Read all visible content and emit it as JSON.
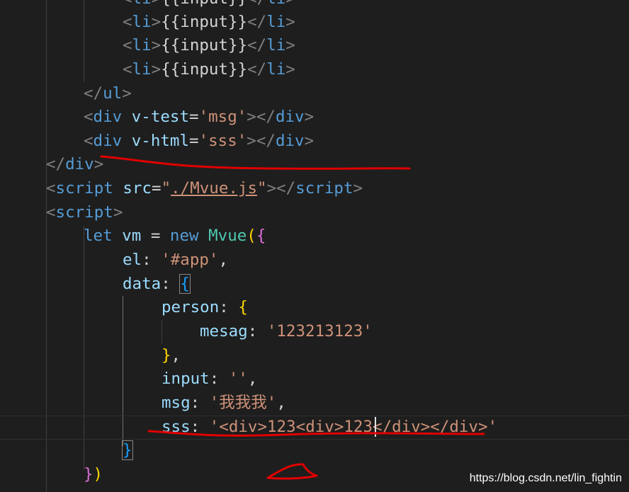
{
  "editor": {
    "lines": [
      [
        {
          "c": "punct",
          "t": "<"
        },
        {
          "c": "tag",
          "t": "li"
        },
        {
          "c": "punct",
          "t": ">"
        },
        {
          "c": "txt",
          "t": "{{input}}"
        },
        {
          "c": "punct",
          "t": "</"
        },
        {
          "c": "tag",
          "t": "li"
        },
        {
          "c": "punct",
          "t": ">"
        }
      ],
      [
        {
          "c": "punct",
          "t": "<"
        },
        {
          "c": "tag",
          "t": "li"
        },
        {
          "c": "punct",
          "t": ">"
        },
        {
          "c": "txt",
          "t": "{{input}}"
        },
        {
          "c": "punct",
          "t": "</"
        },
        {
          "c": "tag",
          "t": "li"
        },
        {
          "c": "punct",
          "t": ">"
        }
      ],
      [
        {
          "c": "punct",
          "t": "<"
        },
        {
          "c": "tag",
          "t": "li"
        },
        {
          "c": "punct",
          "t": ">"
        },
        {
          "c": "txt",
          "t": "{{input}}"
        },
        {
          "c": "punct",
          "t": "</"
        },
        {
          "c": "tag",
          "t": "li"
        },
        {
          "c": "punct",
          "t": ">"
        }
      ],
      [
        {
          "c": "punct",
          "t": "<"
        },
        {
          "c": "tag",
          "t": "li"
        },
        {
          "c": "punct",
          "t": ">"
        },
        {
          "c": "txt",
          "t": "{{input}}"
        },
        {
          "c": "punct",
          "t": "</"
        },
        {
          "c": "tag",
          "t": "li"
        },
        {
          "c": "punct",
          "t": ">"
        }
      ],
      [
        {
          "c": "punct",
          "t": "</"
        },
        {
          "c": "tag",
          "t": "ul"
        },
        {
          "c": "punct",
          "t": ">"
        }
      ],
      [
        {
          "c": "punct",
          "t": "<"
        },
        {
          "c": "tag",
          "t": "div"
        },
        {
          "c": "txt",
          "t": " "
        },
        {
          "c": "attr",
          "t": "v-test"
        },
        {
          "c": "txt",
          "t": "="
        },
        {
          "c": "str",
          "t": "'msg'"
        },
        {
          "c": "punct",
          "t": "></"
        },
        {
          "c": "tag",
          "t": "div"
        },
        {
          "c": "punct",
          "t": ">"
        }
      ],
      [
        {
          "c": "punct",
          "t": "<"
        },
        {
          "c": "tag",
          "t": "div"
        },
        {
          "c": "txt",
          "t": " "
        },
        {
          "c": "attr",
          "t": "v-html"
        },
        {
          "c": "txt",
          "t": "="
        },
        {
          "c": "str",
          "t": "'sss'"
        },
        {
          "c": "punct",
          "t": "></"
        },
        {
          "c": "tag",
          "t": "div"
        },
        {
          "c": "punct",
          "t": ">"
        }
      ],
      [
        {
          "c": "punct",
          "t": "</"
        },
        {
          "c": "tag",
          "t": "div"
        },
        {
          "c": "punct",
          "t": ">"
        }
      ],
      [
        {
          "c": "punct",
          "t": "<"
        },
        {
          "c": "tag",
          "t": "script"
        },
        {
          "c": "txt",
          "t": " "
        },
        {
          "c": "attr",
          "t": "src"
        },
        {
          "c": "txt",
          "t": "="
        },
        {
          "c": "str",
          "t": "\""
        },
        {
          "c": "str link-underline",
          "t": "./Mvue.js"
        },
        {
          "c": "str",
          "t": "\""
        },
        {
          "c": "punct",
          "t": "></"
        },
        {
          "c": "tag",
          "t": "script"
        },
        {
          "c": "punct",
          "t": ">"
        }
      ],
      [
        {
          "c": "punct",
          "t": "<"
        },
        {
          "c": "tag",
          "t": "script"
        },
        {
          "c": "punct",
          "t": ">"
        }
      ],
      [
        {
          "c": "kw",
          "t": "let"
        },
        {
          "c": "txt",
          "t": " "
        },
        {
          "c": "var",
          "t": "vm"
        },
        {
          "c": "txt",
          "t": " = "
        },
        {
          "c": "kw",
          "t": "new"
        },
        {
          "c": "txt",
          "t": " "
        },
        {
          "c": "cls",
          "t": "Mvue"
        },
        {
          "c": "brace1",
          "t": "("
        },
        {
          "c": "brace2",
          "t": "{"
        }
      ],
      [
        {
          "c": "var",
          "t": "el"
        },
        {
          "c": "txt",
          "t": ": "
        },
        {
          "c": "str",
          "t": "'#app'"
        },
        {
          "c": "txt",
          "t": ","
        }
      ],
      [
        {
          "c": "var",
          "t": "data"
        },
        {
          "c": "txt",
          "t": ": "
        },
        {
          "c": "brace3 bracket-box",
          "t": "{"
        }
      ],
      [
        {
          "c": "var",
          "t": "person"
        },
        {
          "c": "txt",
          "t": ": "
        },
        {
          "c": "brace1",
          "t": "{"
        }
      ],
      [
        {
          "c": "var",
          "t": "mesag"
        },
        {
          "c": "txt",
          "t": ": "
        },
        {
          "c": "str",
          "t": "'123213123'"
        }
      ],
      [
        {
          "c": "brace1",
          "t": "}"
        },
        {
          "c": "txt",
          "t": ","
        }
      ],
      [
        {
          "c": "var",
          "t": "input"
        },
        {
          "c": "txt",
          "t": ": "
        },
        {
          "c": "str",
          "t": "''"
        },
        {
          "c": "txt",
          "t": ","
        }
      ],
      [
        {
          "c": "var",
          "t": "msg"
        },
        {
          "c": "txt",
          "t": ": "
        },
        {
          "c": "str",
          "t": "'我我我'"
        },
        {
          "c": "txt",
          "t": ","
        }
      ],
      [
        {
          "c": "var",
          "t": "sss"
        },
        {
          "c": "txt",
          "t": ": "
        },
        {
          "c": "str",
          "t": "'<div>123<div>123</div></div>'"
        }
      ],
      [
        {
          "c": "brace3 bracket-box",
          "t": "}"
        }
      ],
      [
        {
          "c": "brace2",
          "t": "}"
        },
        {
          "c": "brace1",
          "t": ")"
        }
      ]
    ]
  },
  "watermark": {
    "text": "https://blog.csdn.net/lin_fightin"
  },
  "colors": {
    "background": "#1e1e1e",
    "tag": "#569cd6",
    "punctuation": "#808080",
    "attribute": "#9cdcfe",
    "string": "#ce9178",
    "class": "#4ec9b0",
    "annotation": "#e00000"
  }
}
